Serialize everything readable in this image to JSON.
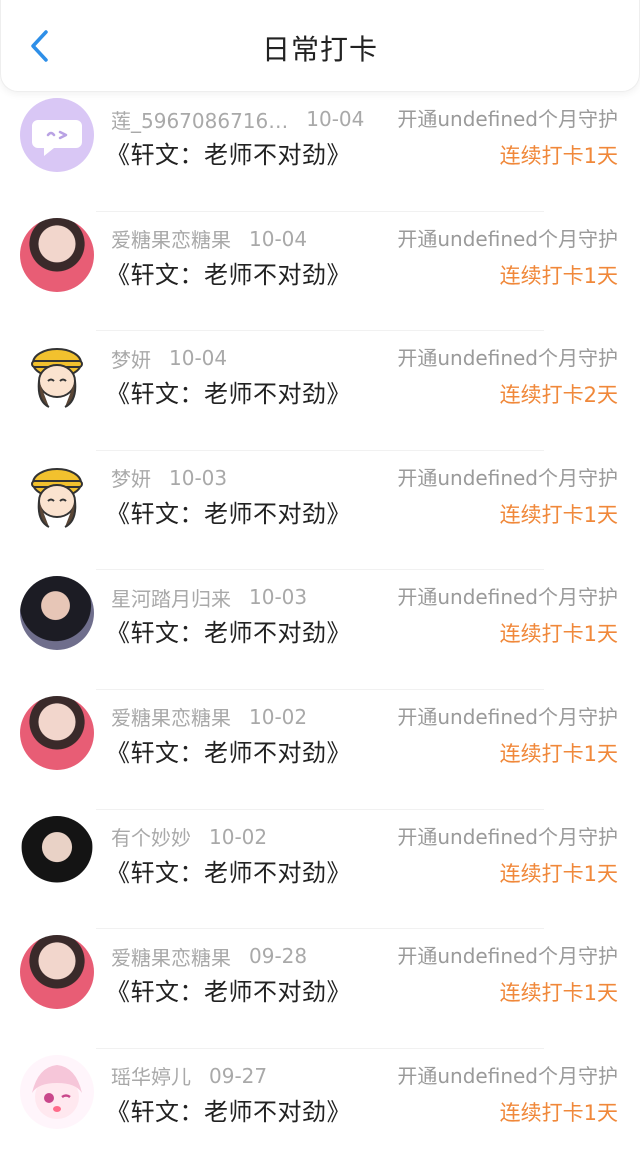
{
  "header": {
    "title": "日常打卡",
    "back_icon": "chevron-left-icon",
    "accent": "#2e8fe8"
  },
  "colors": {
    "streak": "#f0883a",
    "meta": "#a9a9a9"
  },
  "items": [
    {
      "name": "莲_5967086716…",
      "date": "10-04",
      "guard": "开通undefined个月守护",
      "book": "《轩文：老师不对劲》",
      "streak": "连续打卡1天",
      "avatar": "chat-bubble-avatar"
    },
    {
      "name": "爱糖果恋糖果",
      "date": "10-04",
      "guard": "开通undefined个月守护",
      "book": "《轩文：老师不对劲》",
      "streak": "连续打卡1天",
      "avatar": "user-avatar-photo"
    },
    {
      "name": "梦妍",
      "date": "10-04",
      "guard": "开通undefined个月守护",
      "book": "《轩文：老师不对劲》",
      "streak": "连续打卡2天",
      "avatar": "cartoon-hat-avatar"
    },
    {
      "name": "梦妍",
      "date": "10-03",
      "guard": "开通undefined个月守护",
      "book": "《轩文：老师不对劲》",
      "streak": "连续打卡1天",
      "avatar": "cartoon-hat-avatar"
    },
    {
      "name": "星河踏月归来",
      "date": "10-03",
      "guard": "开通undefined个月守护",
      "book": "《轩文：老师不对劲》",
      "streak": "连续打卡1天",
      "avatar": "user-avatar-photo"
    },
    {
      "name": "爱糖果恋糖果",
      "date": "10-02",
      "guard": "开通undefined个月守护",
      "book": "《轩文：老师不对劲》",
      "streak": "连续打卡1天",
      "avatar": "user-avatar-photo"
    },
    {
      "name": "有个妙妙",
      "date": "10-02",
      "guard": "开通undefined个月守护",
      "book": "《轩文：老师不对劲》",
      "streak": "连续打卡1天",
      "avatar": "user-avatar-photo"
    },
    {
      "name": "爱糖果恋糖果",
      "date": "09-28",
      "guard": "开通undefined个月守护",
      "book": "《轩文：老师不对劲》",
      "streak": "连续打卡1天",
      "avatar": "user-avatar-photo"
    },
    {
      "name": "瑶华婷儿",
      "date": "09-27",
      "guard": "开通undefined个月守护",
      "book": "《轩文：老师不对劲》",
      "streak": "连续打卡1天",
      "avatar": "anime-avatar"
    }
  ]
}
